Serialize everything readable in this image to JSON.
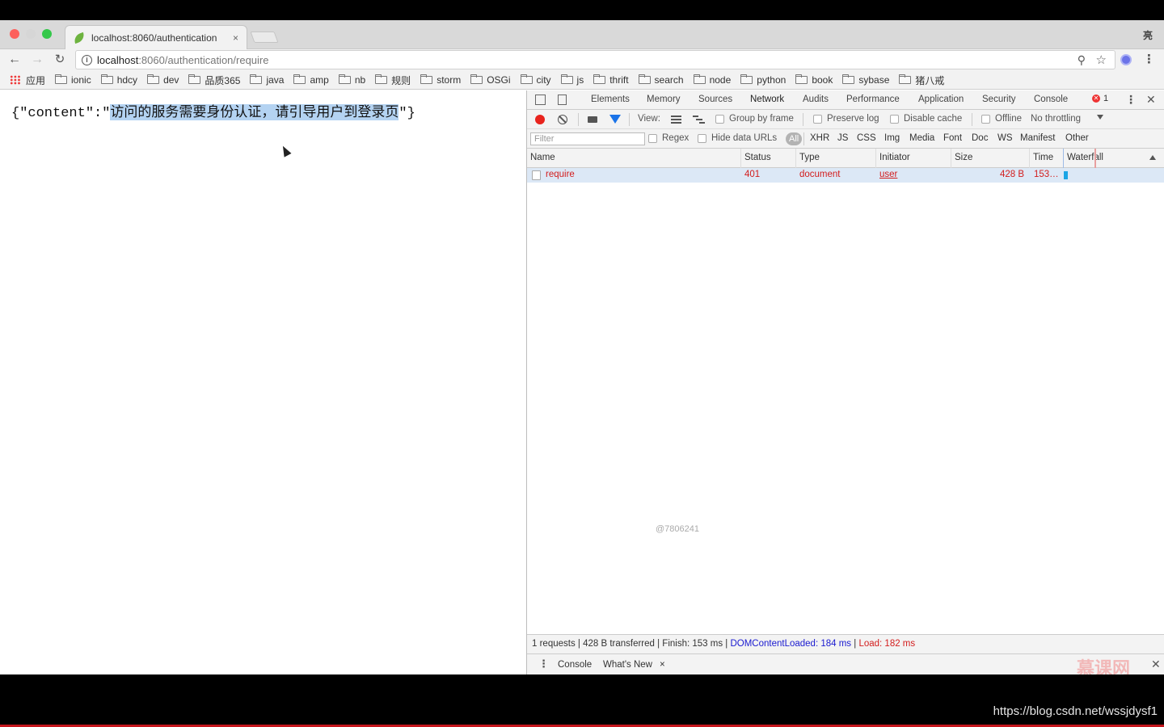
{
  "browser": {
    "tab_title": "localhost:8060/authentication",
    "tab_close": "×",
    "profile_glyph": "亮",
    "url_host": "localhost",
    "url_rest": ":8060/authentication/require",
    "bookmarks": [
      "应用",
      "ionic",
      "hdcy",
      "dev",
      "品质365",
      "java",
      "amp",
      "nb",
      "规则",
      "storm",
      "OSGi",
      "city",
      "js",
      "thrift",
      "search",
      "node",
      "python",
      "book",
      "sybase",
      "猪八戒"
    ]
  },
  "page": {
    "json_prefix": "{\"content\":\"",
    "json_value": "访问的服务需要身份认证，请引导用户到登录页",
    "json_suffix": "\"}"
  },
  "devtools": {
    "tabs": [
      "Elements",
      "Memory",
      "Sources",
      "Network",
      "Audits",
      "Performance",
      "Application",
      "Security",
      "Console"
    ],
    "active_tab": "Network",
    "error_count": "1",
    "toolbar": {
      "view_label": "View:",
      "group_by_frame": "Group by frame",
      "preserve_log": "Preserve log",
      "disable_cache": "Disable cache",
      "offline": "Offline",
      "throttling": "No throttling"
    },
    "filter": {
      "placeholder": "Filter",
      "regex": "Regex",
      "hide_data_urls": "Hide data URLs",
      "all": "All",
      "types": [
        "XHR",
        "JS",
        "CSS",
        "Img",
        "Media",
        "Font",
        "Doc",
        "WS",
        "Manifest",
        "Other"
      ]
    },
    "columns": [
      "Name",
      "Status",
      "Type",
      "Initiator",
      "Size",
      "Time",
      "Waterfall"
    ],
    "rows": [
      {
        "name": "require",
        "status": "401",
        "type": "document",
        "initiator": "user",
        "size": "428 B",
        "time": "153…"
      }
    ],
    "watermark": "@7806241",
    "summary": {
      "main": "1 requests | 428 B transferred | Finish: 153 ms | ",
      "dom": "DOMContentLoaded: 184 ms",
      "sep": " | ",
      "load": "Load: 182 ms"
    },
    "drawer": {
      "tabs": [
        "Console",
        "What's New"
      ],
      "close": "×",
      "logo": "慕课网"
    }
  },
  "overlay": {
    "credit": "https://blog.csdn.net/wssjdysf1"
  }
}
